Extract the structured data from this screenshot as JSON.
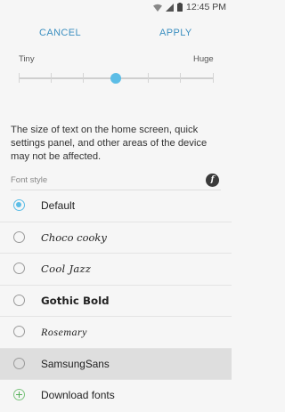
{
  "status_bar": {
    "time": "12:45 PM"
  },
  "action_bar": {
    "cancel_label": "CANCEL",
    "apply_label": "APPLY"
  },
  "font_size": {
    "min_label": "Tiny",
    "max_label": "Huge",
    "step_count": 7,
    "selected_step": 4,
    "description": "The size of text on the home screen, quick settings panel, and other areas of the device may not be affected."
  },
  "font_style": {
    "header": "Font style",
    "store_icon": "ff-icon",
    "options": [
      {
        "label": "Default",
        "selected": true
      },
      {
        "label": "Choco cooky",
        "selected": false
      },
      {
        "label": "Cool Jazz",
        "selected": false
      },
      {
        "label": "Gothic Bold",
        "selected": false
      },
      {
        "label": "Rosemary",
        "selected": false
      },
      {
        "label": "SamsungSans",
        "selected": false,
        "highlighted": true
      }
    ],
    "download_label": "Download fonts"
  },
  "colors": {
    "accent": "#5cbde6",
    "action": "#3c8fc0",
    "add": "#57b15a"
  }
}
